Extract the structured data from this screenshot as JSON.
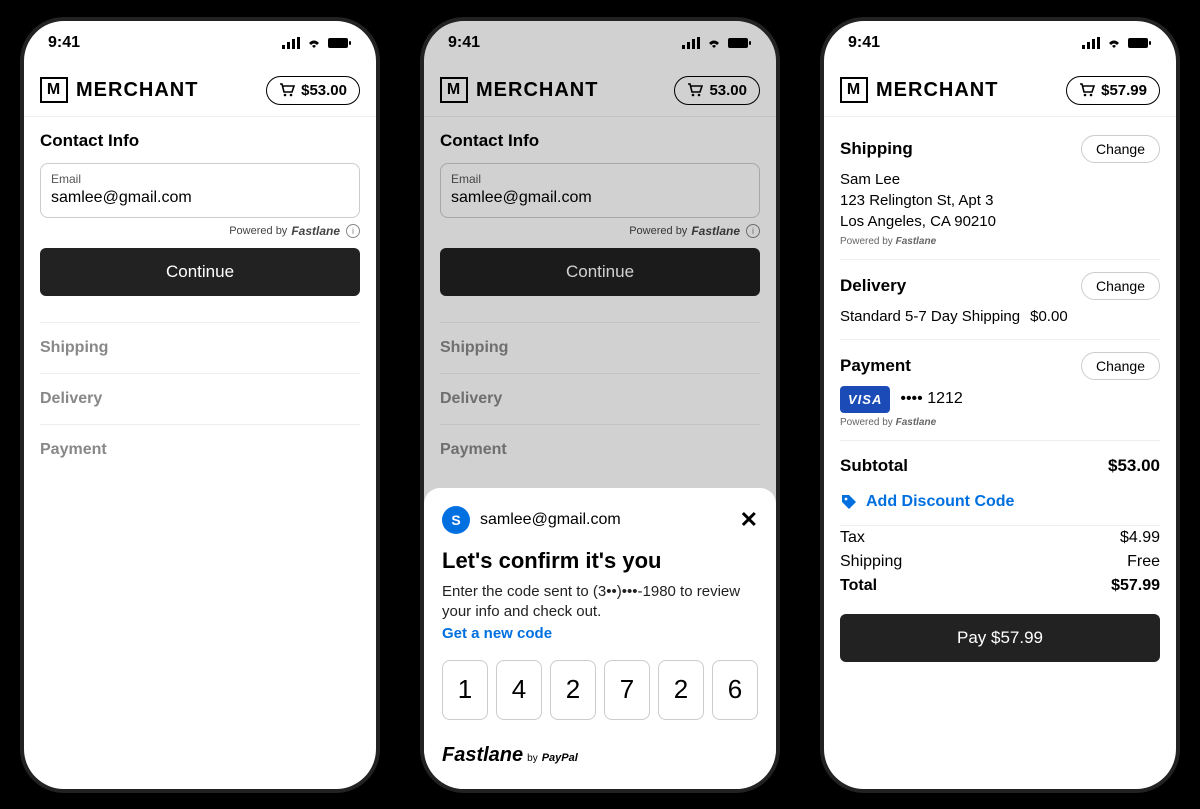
{
  "status": {
    "time": "9:41"
  },
  "brand": {
    "mark": "M",
    "name": "MERCHANT"
  },
  "screen1": {
    "cart_total": "$53.00",
    "section": "Contact Info",
    "email_label": "Email",
    "email_value": "samlee@gmail.com",
    "powered": "Powered by",
    "fastlane": "Fastlane",
    "continue": "Continue",
    "steps": [
      "Shipping",
      "Delivery",
      "Payment"
    ]
  },
  "screen2": {
    "cart_total": "53.00",
    "section": "Contact Info",
    "email_label": "Email",
    "email_value": "samlee@gmail.com",
    "powered": "Powered by",
    "fastlane": "Fastlane",
    "continue": "Continue",
    "steps": [
      "Shipping",
      "Delivery",
      "Payment"
    ],
    "sheet": {
      "avatar_initial": "S",
      "user_email": "samlee@gmail.com",
      "title": "Let's confirm it's you",
      "desc": "Enter the code sent to (3••)•••-1980 to review your info and check out.",
      "new_code": "Get a new code",
      "otp": [
        "1",
        "4",
        "2",
        "7",
        "2",
        "6"
      ],
      "footer_brand": "Fastlane",
      "footer_by": "by",
      "footer_paypal": "PayPal"
    }
  },
  "screen3": {
    "cart_total": "$57.99",
    "shipping": {
      "heading": "Shipping",
      "change": "Change",
      "name": "Sam Lee",
      "addr1": "123 Relington St, Apt 3",
      "addr2": "Los Angeles, CA 90210",
      "powered": "Powered by",
      "fastlane": "Fastlane"
    },
    "delivery": {
      "heading": "Delivery",
      "change": "Change",
      "method": "Standard 5-7 Day Shipping",
      "price": "$0.00"
    },
    "payment": {
      "heading": "Payment",
      "change": "Change",
      "card_brand": "VISA",
      "masked": "•••• 1212",
      "powered": "Powered by",
      "fastlane": "Fastlane"
    },
    "totals": {
      "subtotal_label": "Subtotal",
      "subtotal": "$53.00",
      "discount": "Add Discount Code",
      "tax_label": "Tax",
      "tax": "$4.99",
      "ship_label": "Shipping",
      "ship": "Free",
      "total_label": "Total",
      "total": "$57.99",
      "pay_btn": "Pay $57.99"
    }
  }
}
